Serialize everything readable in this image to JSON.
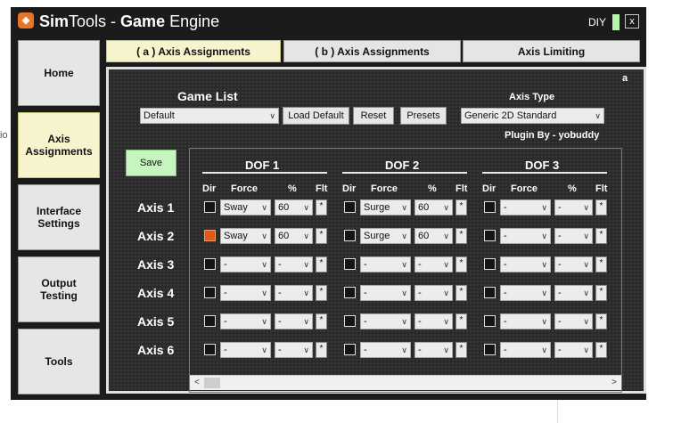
{
  "background": {
    "side_text": "io"
  },
  "titlebar": {
    "app_icon": "simtools-logo-icon",
    "title_sim": "Sim",
    "title_tools": "Tools - ",
    "title_game": "Game",
    "title_engine": " Engine",
    "diy_label": "DIY",
    "close_label": "x"
  },
  "nav": {
    "home": "Home",
    "axis_assignments_1": "Axis",
    "axis_assignments_2": "Assignments",
    "interface_settings_1": "Interface",
    "interface_settings_2": "Settings",
    "output_testing_1": "Output",
    "output_testing_2": "Testing",
    "tools": "Tools"
  },
  "tabs": {
    "a_axis": "( a ) Axis Assignments",
    "b_axis": "( b ) Axis Assignments",
    "limiting": "Axis Limiting"
  },
  "panel": {
    "corner_label": "a",
    "game_list_label": "Game List",
    "game_list_value": "Default",
    "load_default": "Load Default",
    "reset": "Reset",
    "presets": "Presets",
    "axis_type_label": "Axis Type",
    "axis_type_value": "Generic 2D Standard",
    "plugin_by": "Plugin By - yobuddy",
    "save": "Save"
  },
  "dof": [
    {
      "title": "DOF 1",
      "dir": "Dir",
      "force": "Force",
      "pct": "%",
      "flt": "Flt"
    },
    {
      "title": "DOF 2",
      "dir": "Dir",
      "force": "Force",
      "pct": "%",
      "flt": "Flt"
    },
    {
      "title": "DOF 3",
      "dir": "Dir",
      "force": "Force",
      "pct": "%",
      "flt": "Flt"
    }
  ],
  "flt_value": "*",
  "axes": [
    {
      "label": "Axis 1",
      "cells": [
        {
          "checked": false,
          "force": "Sway",
          "pct": "60"
        },
        {
          "checked": false,
          "force": "Surge",
          "pct": "60"
        },
        {
          "checked": false,
          "force": "-",
          "pct": "-"
        }
      ]
    },
    {
      "label": "Axis 2",
      "cells": [
        {
          "checked": true,
          "force": "Sway",
          "pct": "60"
        },
        {
          "checked": false,
          "force": "Surge",
          "pct": "60"
        },
        {
          "checked": false,
          "force": "-",
          "pct": "-"
        }
      ]
    },
    {
      "label": "Axis 3",
      "cells": [
        {
          "checked": false,
          "force": "-",
          "pct": "-"
        },
        {
          "checked": false,
          "force": "-",
          "pct": "-"
        },
        {
          "checked": false,
          "force": "-",
          "pct": "-"
        }
      ]
    },
    {
      "label": "Axis 4",
      "cells": [
        {
          "checked": false,
          "force": "-",
          "pct": "-"
        },
        {
          "checked": false,
          "force": "-",
          "pct": "-"
        },
        {
          "checked": false,
          "force": "-",
          "pct": "-"
        }
      ]
    },
    {
      "label": "Axis 5",
      "cells": [
        {
          "checked": false,
          "force": "-",
          "pct": "-"
        },
        {
          "checked": false,
          "force": "-",
          "pct": "-"
        },
        {
          "checked": false,
          "force": "-",
          "pct": "-"
        }
      ]
    },
    {
      "label": "Axis 6",
      "cells": [
        {
          "checked": false,
          "force": "-",
          "pct": "-"
        },
        {
          "checked": false,
          "force": "-",
          "pct": "-"
        },
        {
          "checked": false,
          "force": "-",
          "pct": "-"
        }
      ]
    }
  ],
  "scroll": {
    "left": "<",
    "right": ">"
  },
  "colors": {
    "checked": "#e05a14",
    "active_tab": "#f6f3cd",
    "save": "#c6f5c0"
  }
}
